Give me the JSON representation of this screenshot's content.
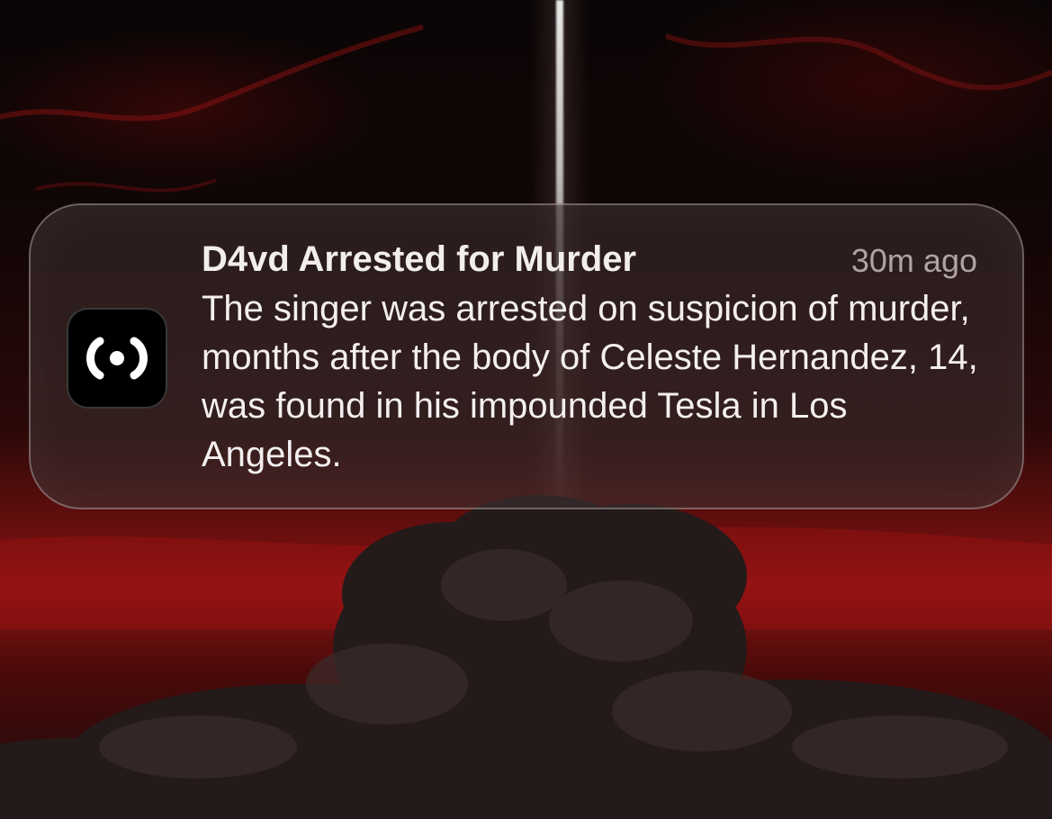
{
  "notification": {
    "app_icon": "broadcast-signal-icon",
    "title": "D4vd Arrested for Murder",
    "time": "30m ago",
    "body": "The singer was arrested on suspicion of murder, months after the body of Celeste Hernandez, 14, was found in his impounded Tesla in Los Angeles."
  },
  "colors": {
    "wallpaper_red": "#8a1212",
    "wallpaper_dark": "#070303",
    "card_background": "rgba(58,44,44,0.62)",
    "title_text": "#f2eeee",
    "time_text": "rgba(230,215,215,0.72)"
  }
}
